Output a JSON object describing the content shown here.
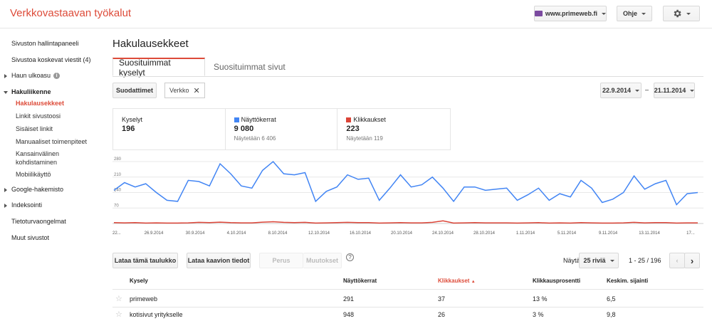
{
  "app": {
    "title": "Verkkovastaavan työkalut"
  },
  "header": {
    "site_label": "www.primeweb.fi",
    "help_label": "Ohje",
    "settings_icon": "gear-icon"
  },
  "sidebar": {
    "items": [
      {
        "label": "Sivuston hallintapaneeli"
      },
      {
        "label": "Sivustoa koskevat viestit (4)"
      },
      {
        "label": "Haun ulkoasu"
      },
      {
        "label": "Hakuliikenne"
      },
      {
        "label": "Google-hakemisto"
      },
      {
        "label": "Indeksointi"
      },
      {
        "label": "Tietoturvaongelmat"
      },
      {
        "label": "Muut sivustot"
      }
    ],
    "sub": [
      {
        "label": "Hakulausekkeet"
      },
      {
        "label": "Linkit sivustoosi"
      },
      {
        "label": "Sisäiset linkit"
      },
      {
        "label": "Manuaaliset toimenpiteet"
      },
      {
        "label": "Kansainvälinen"
      },
      {
        "label": "kohdistaminen"
      },
      {
        "label": "Mobiilikäyttö"
      }
    ]
  },
  "main": {
    "title": "Hakulausekkeet",
    "tabs": [
      {
        "label": "Suosituimmat kyselyt"
      },
      {
        "label": "Suosituimmat sivut"
      }
    ],
    "filters_label": "Suodattimet",
    "filter_chip": "Verkko",
    "date_from": "22.9.2014",
    "date_to": "21.11.2014",
    "date_sep": "–"
  },
  "stats": [
    {
      "label": "Kyselyt",
      "value": "196",
      "sub": ""
    },
    {
      "label": "Näyttökerrat",
      "value": "9 080",
      "sub": "Näytetään 6 406",
      "color": "#4285f4"
    },
    {
      "label": "Klikkaukset",
      "value": "223",
      "sub": "Näytetään 119",
      "color": "#db4437"
    }
  ],
  "chart_data": {
    "type": "line",
    "y_ticks": [
      "280",
      "210",
      "140",
      "70"
    ],
    "ylim": [
      0,
      280
    ],
    "x_tick_labels": [
      "22...",
      "26.9.2014",
      "30.9.2014",
      "4.10.2014",
      "8.10.2014",
      "12.10.2014",
      "16.10.2014",
      "20.10.2014",
      "24.10.2014",
      "28.10.2014",
      "1.11.2014",
      "5.11.2014",
      "9.11.2014",
      "13.11.2014",
      "17..."
    ],
    "series": [
      {
        "name": "Näyttökerrat",
        "color": "#4285f4",
        "values": [
          150,
          185,
          165,
          180,
          140,
          105,
          100,
          195,
          190,
          170,
          270,
          225,
          170,
          160,
          240,
          280,
          225,
          220,
          230,
          100,
          145,
          165,
          220,
          200,
          205,
          105,
          160,
          220,
          165,
          175,
          210,
          160,
          100,
          165,
          165,
          150,
          155,
          160,
          105,
          130,
          160,
          105,
          135,
          120,
          195,
          160,
          95,
          110,
          140,
          215,
          155,
          180,
          195,
          85,
          135,
          140
        ]
      },
      {
        "name": "Klikkaukset",
        "color": "#db4437",
        "values": [
          4,
          3,
          4,
          2,
          3,
          2,
          2,
          3,
          5,
          4,
          6,
          4,
          3,
          3,
          6,
          8,
          5,
          4,
          5,
          2,
          3,
          4,
          5,
          4,
          4,
          2,
          3,
          4,
          3,
          3,
          5,
          12,
          2,
          3,
          4,
          3,
          3,
          3,
          2,
          3,
          4,
          2,
          3,
          2,
          4,
          3,
          2,
          2,
          3,
          5,
          3,
          4,
          4,
          2,
          3,
          3
        ]
      }
    ]
  },
  "toolbar": {
    "download_table": "Lataa tämä taulukko",
    "download_chart": "Lataa kaavion tiedot",
    "basic": "Perus",
    "changes": "Muutokset",
    "help": "?",
    "show_label": "Näytä",
    "rows_select": "25 riviä",
    "range": "1 - 25 / 196"
  },
  "table": {
    "headers": [
      "Kysely",
      "Näyttökerrat",
      "Klikkaukset",
      "Klikkausprosentti",
      "Keskim. sijainti"
    ],
    "rows": [
      {
        "query": "primeweb",
        "impressions": "291",
        "clicks": "37",
        "ctr": "13 %",
        "position": "6,5"
      },
      {
        "query": "kotisivut yritykselle",
        "impressions": "948",
        "clicks": "26",
        "ctr": "3 %",
        "position": "9,8"
      }
    ]
  }
}
